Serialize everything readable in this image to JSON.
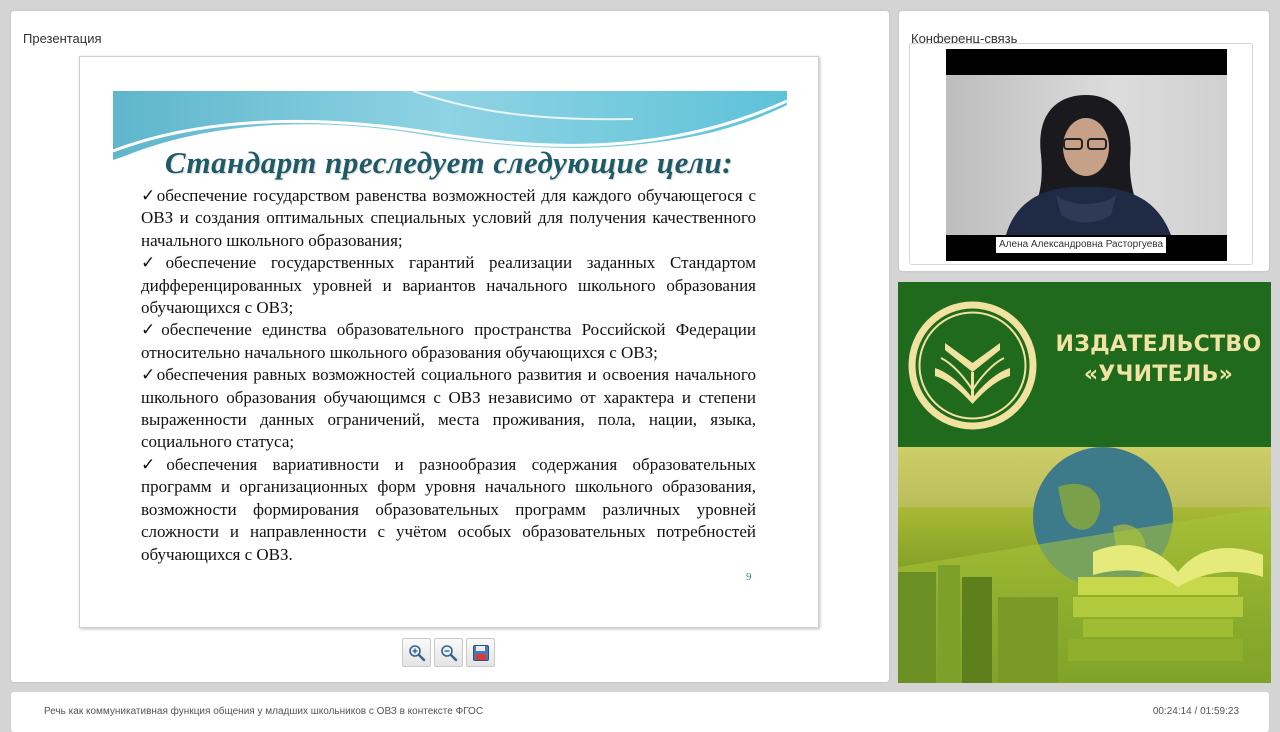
{
  "presentation": {
    "panel_title": "Презентация",
    "slide": {
      "title": "Стандарт преследует следующие цели:",
      "items": [
        "✓обеспечение государством равенства возможностей для каждого обучающегося с ОВЗ и создания оптимальных специальных условий для получения качественного начального школьного образования;",
        "✓обеспечение государственных гарантий реализации заданных Стандартом дифференцированных уровней и вариантов начального школьного образования обучающихся с ОВЗ;",
        "✓обеспечение единства образовательного пространства Российской Федерации относительно начального школьного образования обучающихся с ОВЗ;",
        "✓обеспечения равных возможностей социального развития и освоения начального школьного образования обучающимся с ОВЗ независимо от характера и степени выраженности данных ограничений, места проживания, пола, нации, языка, социального статуса;",
        "✓обеспечения вариативности и разнообразия содержания образовательных программ и организационных форм уровня начального школьного образования, возможности формирования образовательных программ различных уровней сложности и направленности с учётом особых образовательных потребностей обучающихся с ОВЗ."
      ],
      "page_number": "9"
    },
    "toolbar": {
      "zoom_in_icon": "zoom-in-icon",
      "zoom_out_icon": "zoom-out-icon",
      "save_icon": "floppy-disk-icon"
    }
  },
  "conference": {
    "panel_title": "Конференц-связь",
    "speaker_name": "Алена Александровна Расторгуева"
  },
  "ad": {
    "line1": "ИЗДАТЕЛЬСТВО",
    "line2": "«УЧИТЕЛЬ»",
    "logo_icon": "publisher-logo-icon"
  },
  "footer": {
    "course_title": "Речь как коммуникативная функция общения у младших школьников с ОВЗ в контексте ФГОС",
    "time": "00:24:14 / 01:59:23"
  },
  "colors": {
    "slide_title": "#1f5a68",
    "ad_green": "#1f6a1c",
    "ad_text": "#f0e3a4",
    "background": "#d4d4d4"
  }
}
